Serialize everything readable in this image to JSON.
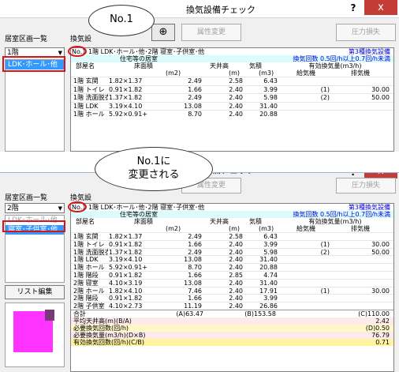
{
  "window_title": "換気設備チェック",
  "help_icon": "?",
  "close_icon": "x",
  "zone_list_label": "居室区画一覧",
  "ventilation_label_partial": "換気設",
  "ventilation_label_partial2": "換気設",
  "floor_select": "1階",
  "toolbar": {
    "attr_change": "属性変更",
    "pressure_loss": "圧力損失"
  },
  "callouts": {
    "first": "No.1",
    "second_line1": "No.1に",
    "second_line2": "変更される"
  },
  "screen1": {
    "list_items": [
      "LDK･ホール･他"
    ],
    "selected_item": "LDK･ホール･他",
    "zone_no": "No.1",
    "zone_name": "1階 LDK･ホール･他･2階 寝室･子供室･他",
    "vent_type": "第3種換気設備",
    "house_row_label": "住宅等の居室",
    "vent_rate": "換気回数 0.5回/h以上0.7回/h未満",
    "headers": {
      "room": "部屋名",
      "floor_area": "床面積",
      "ceiling": "天井高",
      "volume": "気積",
      "effective": "有効換気量(m3/h)",
      "supply": "給気機",
      "exhaust": "排気機"
    },
    "units": {
      "area": "(m2)",
      "height": "(m)",
      "vol": "(m3)"
    },
    "rows": [
      {
        "room": "1階 玄関",
        "calc": "1.82×1.37",
        "area": "2.49",
        "height": "2.58",
        "volume": "6.43",
        "sup_no": "",
        "sup": "",
        "exh_no": "",
        "exh": ""
      },
      {
        "room": "1階 トイレ",
        "calc": "0.91×1.82",
        "area": "1.66",
        "height": "2.40",
        "volume": "3.99",
        "sup_no": "",
        "sup": "",
        "exh_no": "(1)",
        "exh": "30.00"
      },
      {
        "room": "1階 洗面脱衣",
        "calc": "1.37×1.82",
        "area": "2.49",
        "height": "2.40",
        "volume": "5.98",
        "sup_no": "",
        "sup": "",
        "exh_no": "(2)",
        "exh": "50.00"
      },
      {
        "room": "1階 LDK",
        "calc": "3.19×4.10",
        "area": "13.08",
        "height": "2.40",
        "volume": "31.40",
        "sup_no": "",
        "sup": "",
        "exh_no": "",
        "exh": ""
      },
      {
        "room": "1階 ホール",
        "calc": "5.92×0.91+",
        "area": "8.70",
        "height": "2.40",
        "volume": "20.88",
        "sup_no": "",
        "sup": "",
        "exh_no": "",
        "exh": ""
      }
    ]
  },
  "screen2": {
    "list_items": [
      "LDK･ホール･他",
      "寝室･子供室･他"
    ],
    "selected_item": "寝室･子供室･他",
    "floor_select": "2階",
    "zone_no": "No.1",
    "zone_name": "1階 LDK･ホール･他･2階 寝室･子供室･他",
    "vent_type": "第3種換気設備",
    "house_row_label": "住宅等の居室",
    "vent_rate": "換気回数 0.5回/h以上0.7回/h未満",
    "list_edit": "リスト編集",
    "rows": [
      {
        "room": "1階 玄関",
        "calc": "1.82×1.37",
        "area": "2.49",
        "height": "2.58",
        "volume": "6.43",
        "exh_no": "",
        "exh": ""
      },
      {
        "room": "1階 トイレ",
        "calc": "0.91×1.82",
        "area": "1.66",
        "height": "2.40",
        "volume": "3.99",
        "exh_no": "(1)",
        "exh": "30.00"
      },
      {
        "room": "1階 洗面脱衣",
        "calc": "1.37×1.82",
        "area": "2.49",
        "height": "2.40",
        "volume": "5.98",
        "exh_no": "(2)",
        "exh": "50.00"
      },
      {
        "room": "1階 LDK",
        "calc": "3.19×4.10",
        "area": "13.08",
        "height": "2.40",
        "volume": "31.40",
        "exh_no": "",
        "exh": ""
      },
      {
        "room": "1階 ホール",
        "calc": "5.92×0.91+",
        "area": "8.70",
        "height": "2.40",
        "volume": "20.88",
        "exh_no": "",
        "exh": ""
      },
      {
        "room": "1階 階段",
        "calc": "0.91×1.82",
        "area": "1.66",
        "height": "2.85",
        "volume": "4.74",
        "exh_no": "",
        "exh": ""
      },
      {
        "room": "2階 寝室",
        "calc": "4.10×3.19",
        "area": "13.08",
        "height": "2.40",
        "volume": "31.40",
        "exh_no": "",
        "exh": ""
      },
      {
        "room": "2階 ホール",
        "calc": "1.82×4.10",
        "area": "7.46",
        "height": "2.40",
        "volume": "17.91",
        "exh_no": "(1)",
        "exh": "30.00"
      },
      {
        "room": "2階 階段",
        "calc": "0.91×1.82",
        "area": "1.66",
        "height": "2.40",
        "volume": "3.99",
        "exh_no": "",
        "exh": ""
      },
      {
        "room": "2階 子供室",
        "calc": "4.10×2.73",
        "area": "11.19",
        "height": "2.40",
        "volume": "26.86",
        "exh_no": "",
        "exh": ""
      }
    ],
    "total_label": "合計",
    "total_area": "(A)63.47",
    "total_volume": "(B)153.58",
    "total_exhaust": "(C)110.00",
    "summary": [
      {
        "label": "平均天井高(m)(B/A)",
        "value": "2.42"
      },
      {
        "label": "必要換気回数(回/h)",
        "value": "(D)0.50"
      },
      {
        "label": "必要換気量(m3/h)(D×B)",
        "value": "76.79"
      },
      {
        "label": "有効換気回数(回/h)(C/B)",
        "value": "0.71"
      }
    ]
  }
}
